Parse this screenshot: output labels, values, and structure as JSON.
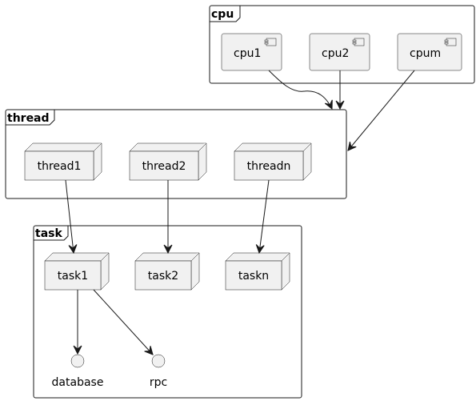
{
  "frames": {
    "cpu": "cpu",
    "thread": "thread",
    "task": "task"
  },
  "components": [
    "cpu1",
    "cpu2",
    "cpum"
  ],
  "threads": [
    "thread1",
    "thread2",
    "threadn"
  ],
  "tasks": [
    "task1",
    "task2",
    "taskn"
  ],
  "interfaces": [
    "database",
    "rpc"
  ],
  "edges": [
    {
      "from": "cpu1",
      "to": "thread"
    },
    {
      "from": "cpu2",
      "to": "thread"
    },
    {
      "from": "cpum",
      "to": "thread"
    },
    {
      "from": "thread1",
      "to": "task1"
    },
    {
      "from": "thread2",
      "to": "task2"
    },
    {
      "from": "threadn",
      "to": "taskn"
    },
    {
      "from": "task1",
      "to": "database"
    },
    {
      "from": "task1",
      "to": "rpc"
    }
  ],
  "colors": {
    "fill": "#F1F1F1",
    "stroke": "#181818"
  }
}
